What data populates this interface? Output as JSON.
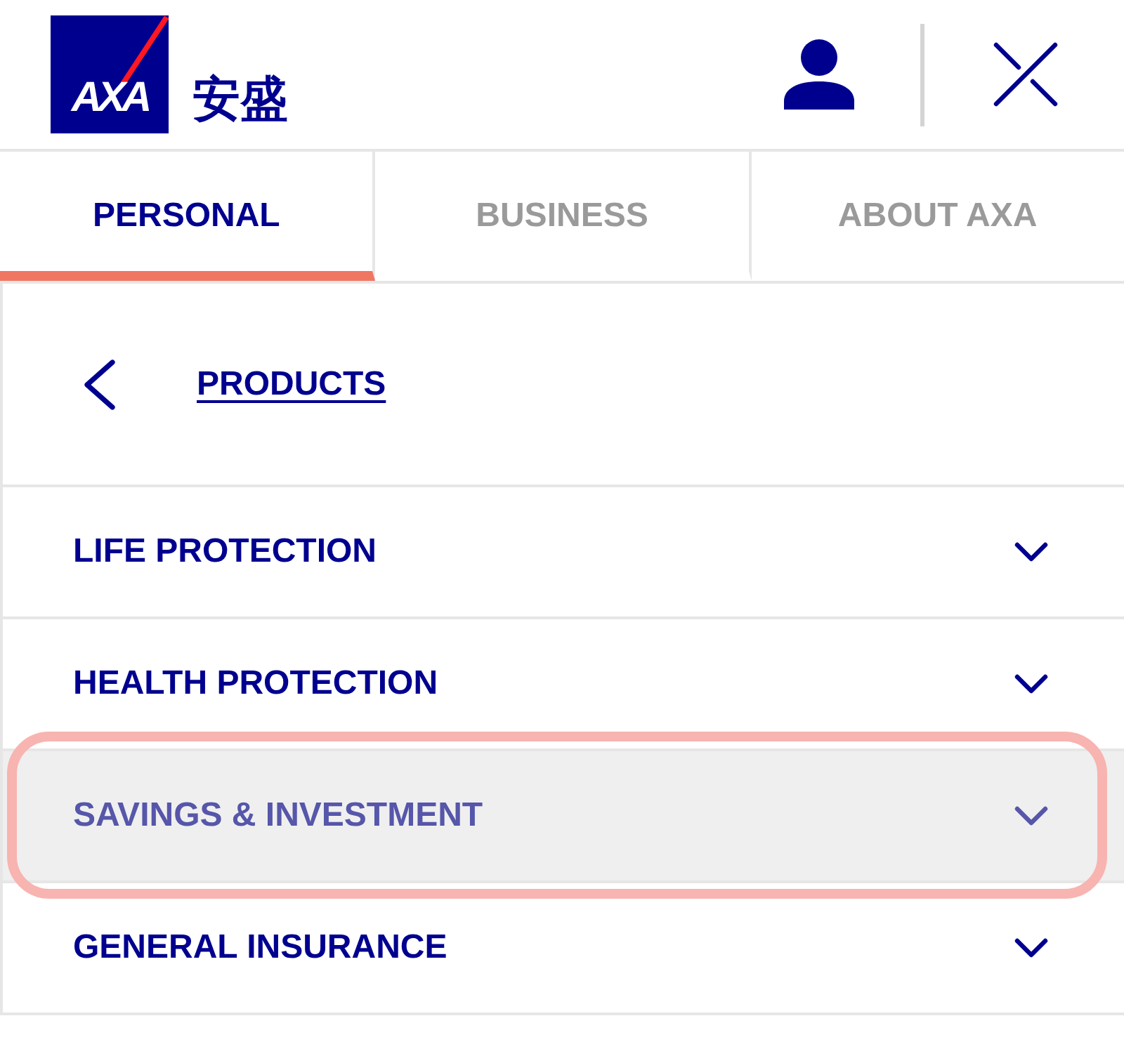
{
  "header": {
    "logo": {
      "text": "AXA",
      "name": "安盛"
    }
  },
  "tabs": [
    {
      "label": "PERSONAL",
      "selected": true
    },
    {
      "label": "BUSINESS",
      "selected": false
    },
    {
      "label": "ABOUT AXA",
      "selected": false
    }
  ],
  "back_link": {
    "label": "PRODUCTS"
  },
  "menu": [
    {
      "label": "LIFE PROTECTION",
      "selected": false
    },
    {
      "label": "HEALTH PROTECTION",
      "selected": false
    },
    {
      "label": "SAVINGS & INVESTMENT",
      "selected": true
    },
    {
      "label": "GENERAL INSURANCE",
      "selected": false
    }
  ]
}
